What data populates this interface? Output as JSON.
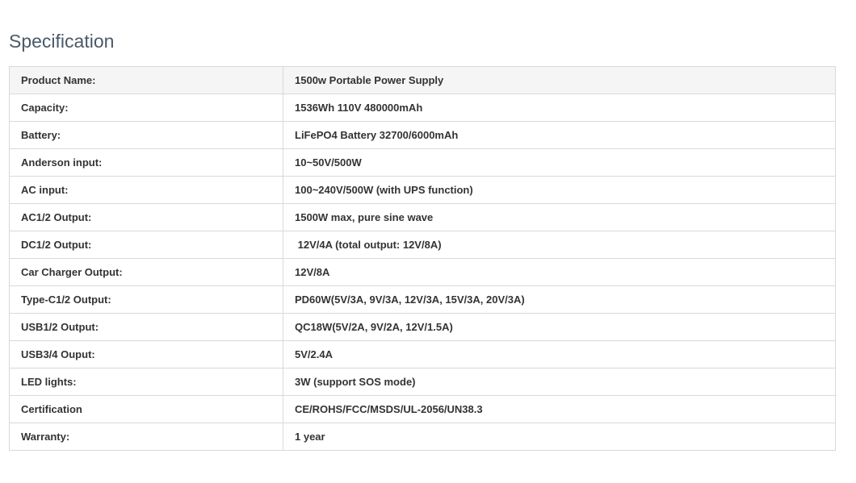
{
  "title": "Specification",
  "rows": [
    {
      "label": "Product Name:",
      "value": "1500w Portable Power Supply"
    },
    {
      "label": "Capacity:",
      "value": "1536Wh 110V 480000mAh"
    },
    {
      "label": "Battery:",
      "value": "LiFePO4 Battery 32700/6000mAh"
    },
    {
      "label": "Anderson input:",
      "value": "10~50V/500W"
    },
    {
      "label": "AC input:",
      "value": "100~240V/500W (with UPS function)"
    },
    {
      "label": "AC1/2 Output:",
      "value": "1500W max, pure sine wave"
    },
    {
      "label": "DC1/2 Output:",
      "value": " 12V/4A (total output: 12V/8A)"
    },
    {
      "label": "Car Charger Output:",
      "value": "12V/8A"
    },
    {
      "label": "Type-C1/2 Output:",
      "value": "PD60W(5V/3A, 9V/3A, 12V/3A, 15V/3A, 20V/3A)"
    },
    {
      "label": "USB1/2 Output:",
      "value": "QC18W(5V/2A, 9V/2A, 12V/1.5A)"
    },
    {
      "label": "USB3/4 Ouput:",
      "value": "5V/2.4A"
    },
    {
      "label": "LED lights:",
      "value": "3W (support SOS mode)"
    },
    {
      "label": "Certification",
      "value": "CE/ROHS/FCC/MSDS/UL-2056/UN38.3"
    },
    {
      "label": "Warranty:",
      "value": "1 year"
    }
  ]
}
